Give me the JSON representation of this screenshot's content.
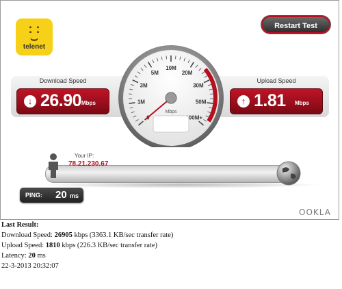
{
  "brand": {
    "name": "telenet",
    "icon": "smiley-logo"
  },
  "restart_button": {
    "label": "Restart Test"
  },
  "download": {
    "title": "Download Speed",
    "value": "26.90",
    "unit": "Mbps",
    "icon": "arrow-down-icon"
  },
  "upload": {
    "title": "Upload Speed",
    "value": "1.81",
    "unit": "Mbps",
    "icon": "arrow-up-icon"
  },
  "gauge": {
    "unit": "Mbps",
    "ticks": [
      "0",
      "1M",
      "3M",
      "5M",
      "10M",
      "20M",
      "30M",
      "50M",
      "100M+"
    ],
    "needle_fraction": 0.0,
    "colors": {
      "accent": "#b60f1f",
      "face": "#ffffff",
      "rim": "#7a7a7a"
    }
  },
  "ip": {
    "label": "Your IP:",
    "value": "78.21.230.67"
  },
  "ping": {
    "label": "PING:",
    "value": "20",
    "unit": "ms"
  },
  "footer_logo": "OOKLA",
  "result": {
    "title": "Last Result:",
    "download_prefix": "Download Speed: ",
    "download_value": "26905",
    "download_suffix": " kbps (3363.1 KB/sec transfer rate)",
    "upload_prefix": "Upload Speed: ",
    "upload_value": "1810",
    "upload_suffix": " kbps (226.3 KB/sec transfer rate)",
    "latency_prefix": "Latency: ",
    "latency_value": "20",
    "latency_suffix": " ms",
    "timestamp": "22-3-2013 20:32:07"
  }
}
